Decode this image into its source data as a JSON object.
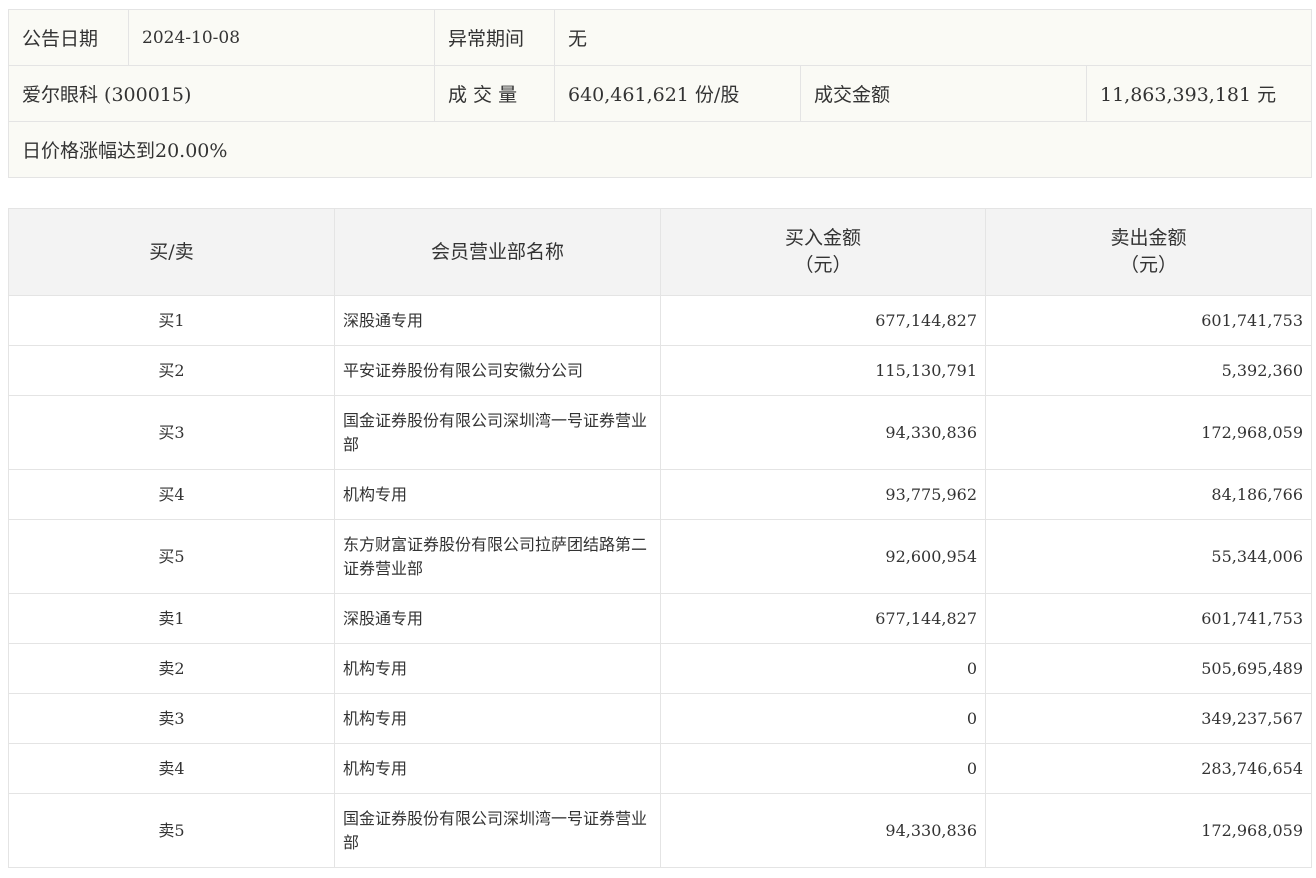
{
  "summary": {
    "date_label": "公告日期",
    "date_value": "2024-10-08",
    "abnormal_label": "异常期间",
    "abnormal_value": "无",
    "stock": "爱尔眼科 (300015)",
    "volume_label": "成 交 量",
    "volume_value": "640,461,621 份/股",
    "amount_label": "成交金额",
    "amount_value": "11,863,393,181 元",
    "reason": "日价格涨幅达到20.00%"
  },
  "table": {
    "headers": {
      "side": "买/卖",
      "member": "会员营业部名称",
      "buy_amount": "买入金额",
      "buy_unit": "（元）",
      "sell_amount": "卖出金额",
      "sell_unit": "（元）"
    },
    "rows": [
      {
        "side": "买1",
        "member": "深股通专用",
        "buy": "677,144,827",
        "sell": "601,741,753"
      },
      {
        "side": "买2",
        "member": "平安证券股份有限公司安徽分公司",
        "buy": "115,130,791",
        "sell": "5,392,360"
      },
      {
        "side": "买3",
        "member": "国金证券股份有限公司深圳湾一号证券营业部",
        "buy": "94,330,836",
        "sell": "172,968,059"
      },
      {
        "side": "买4",
        "member": "机构专用",
        "buy": "93,775,962",
        "sell": "84,186,766"
      },
      {
        "side": "买5",
        "member": "东方财富证券股份有限公司拉萨团结路第二证券营业部",
        "buy": "92,600,954",
        "sell": "55,344,006"
      },
      {
        "side": "卖1",
        "member": "深股通专用",
        "buy": "677,144,827",
        "sell": "601,741,753"
      },
      {
        "side": "卖2",
        "member": "机构专用",
        "buy": "0",
        "sell": "505,695,489"
      },
      {
        "side": "卖3",
        "member": "机构专用",
        "buy": "0",
        "sell": "349,237,567"
      },
      {
        "side": "卖4",
        "member": "机构专用",
        "buy": "0",
        "sell": "283,746,654"
      },
      {
        "side": "卖5",
        "member": "国金证券股份有限公司深圳湾一号证券营业部",
        "buy": "94,330,836",
        "sell": "172,968,059"
      }
    ]
  }
}
